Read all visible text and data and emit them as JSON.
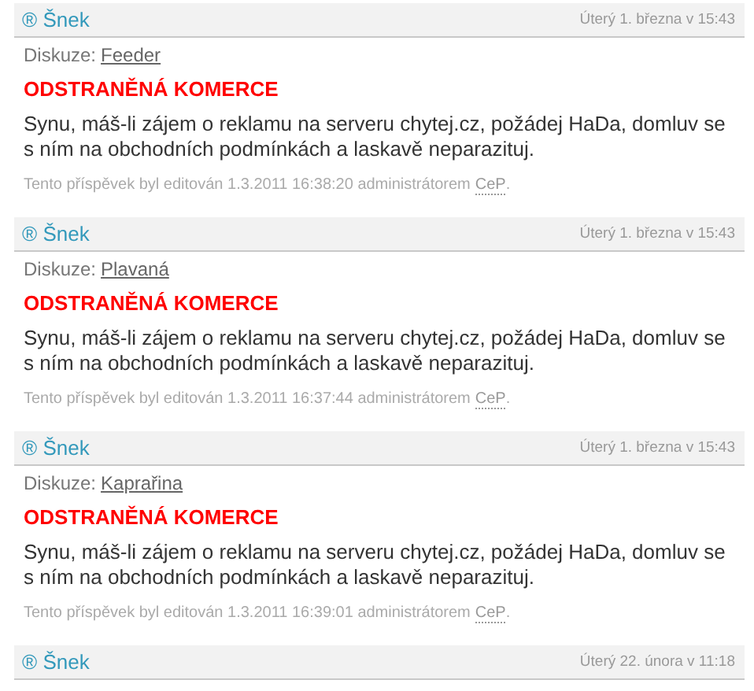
{
  "posts": [
    {
      "author": "® Šnek",
      "date": "Úterý 1. března v 15:43",
      "discussion_label": "Diskuze:",
      "discussion": "Feeder",
      "heading": "ODSTRANĚNÁ KOMERCE",
      "text": "Synu, máš-li zájem o reklamu na serveru chytej.cz, požádej HaDa, domluv se s ním na obchodních podmínkách a laskavě neparazituj.",
      "edit_note": "Tento příspěvek byl editován 1.3.2011 16:38:20 administrátorem",
      "editor": "CeP",
      "edit_end": "."
    },
    {
      "author": "® Šnek",
      "date": "Úterý 1. března v 15:43",
      "discussion_label": "Diskuze:",
      "discussion": "Plavaná",
      "heading": "ODSTRANĚNÁ KOMERCE",
      "text": "Synu, máš-li zájem o reklamu na serveru chytej.cz, požádej HaDa, domluv se s ním na obchodních podmínkách a laskavě neparazituj.",
      "edit_note": "Tento příspěvek byl editován 1.3.2011 16:37:44 administrátorem",
      "editor": "CeP",
      "edit_end": "."
    },
    {
      "author": "® Šnek",
      "date": "Úterý 1. března v 15:43",
      "discussion_label": "Diskuze:",
      "discussion": "Kaprařina",
      "heading": "ODSTRANĚNÁ KOMERCE",
      "text": "Synu, máš-li zájem o reklamu na serveru chytej.cz, požádej HaDa, domluv se s ním na obchodních podmínkách a laskavě neparazituj.",
      "edit_note": "Tento příspěvek byl editován 1.3.2011 16:39:01 administrátorem",
      "editor": "CeP",
      "edit_end": "."
    },
    {
      "author": "® Šnek",
      "date": "Úterý 22. února v 11:18"
    }
  ]
}
